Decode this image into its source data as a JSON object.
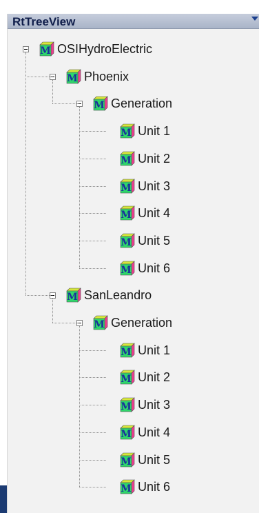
{
  "window": {
    "title": "RtTreeView"
  },
  "tree": {
    "root": {
      "label": "OSIHydroElectric",
      "children": [
        {
          "label": "Phoenix",
          "children": [
            {
              "label": "Generation",
              "children": [
                "Unit 1",
                "Unit 2",
                "Unit 3",
                "Unit 4",
                "Unit 5",
                "Unit 6"
              ]
            }
          ]
        },
        {
          "label": "SanLeandro",
          "children": [
            {
              "label": "Generation",
              "children": [
                "Unit 1",
                "Unit 2",
                "Unit 3",
                "Unit 4",
                "Unit 5",
                "Unit 6"
              ]
            }
          ]
        }
      ]
    }
  },
  "colors": {
    "header_text": "#0f1d4a",
    "panel_bg": "#f2f2f2",
    "icon_letter": "#1a2f9a",
    "icon_face": "#2fd66b"
  },
  "icons": {
    "node": "m-cube-icon",
    "expanded": "minus-expander-icon"
  }
}
